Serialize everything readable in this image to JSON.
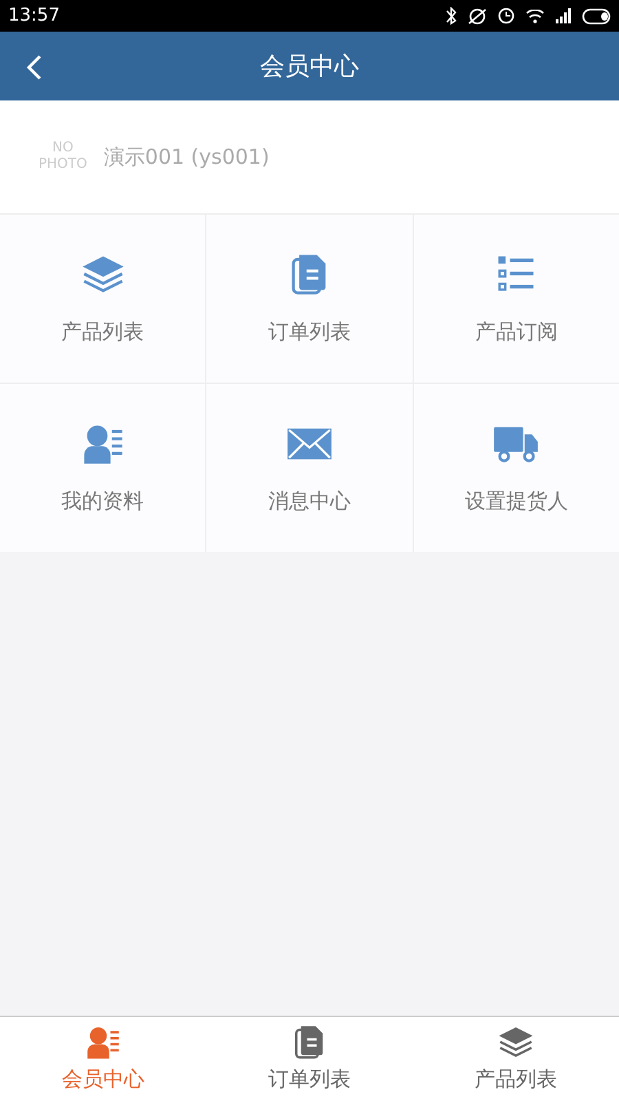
{
  "status_bar": {
    "time": "13:57"
  },
  "header": {
    "title": "会员中心"
  },
  "profile": {
    "photo_placeholder": [
      "NO",
      "PHOTO"
    ],
    "name": "演示001 (ys001)"
  },
  "menu": [
    {
      "label": "产品列表",
      "kind": "layers"
    },
    {
      "label": "订单列表",
      "kind": "document"
    },
    {
      "label": "产品订阅",
      "kind": "list"
    },
    {
      "label": "我的资料",
      "kind": "profile"
    },
    {
      "label": "消息中心",
      "kind": "mail"
    },
    {
      "label": "设置提货人",
      "kind": "truck"
    }
  ],
  "tab_bar": [
    {
      "label": "会员中心",
      "kind": "profile",
      "selected": true
    },
    {
      "label": "订单列表",
      "kind": "document",
      "selected": false
    },
    {
      "label": "产品列表",
      "kind": "layers",
      "selected": false
    }
  ]
}
